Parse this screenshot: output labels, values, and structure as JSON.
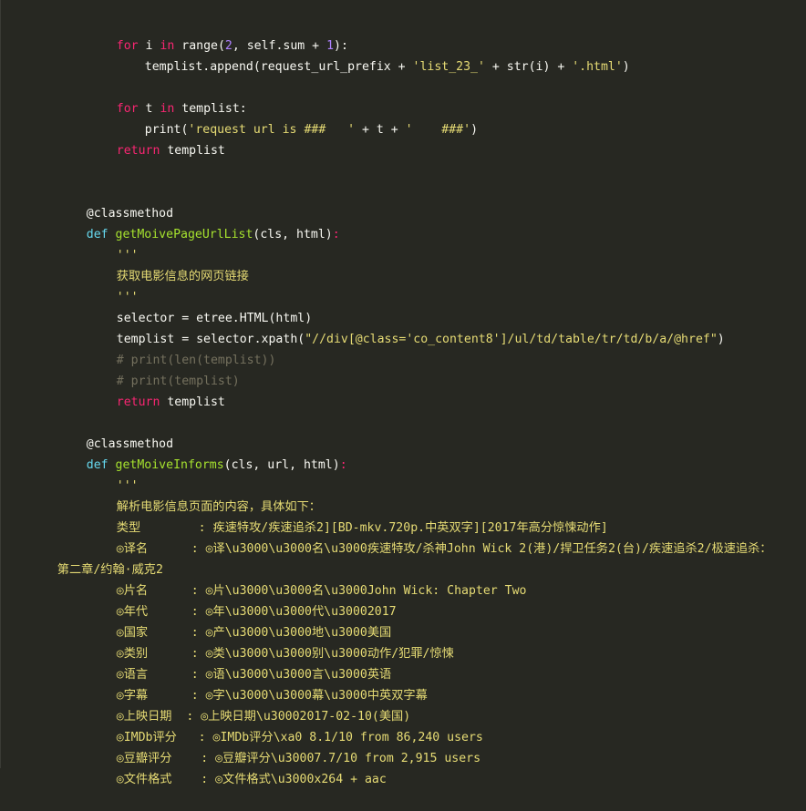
{
  "code_block": {
    "language": "python",
    "theme_colors": {
      "background": "#272822",
      "keyword": "#f92672",
      "def_keyword": "#66d9ef",
      "function_name": "#a6e22e",
      "number": "#ae81ff",
      "string": "#e6db74",
      "comment": "#75715e",
      "text": "#f8f8f2"
    },
    "lines": {
      "l1": {
        "kw1": "for",
        "a": " i ",
        "kw2": "in",
        "b": " range(",
        "n1": "2",
        "c": ", self.sum + ",
        "n2": "1",
        "d": "):"
      },
      "l2": {
        "a": "templist.append(request_url_prefix + ",
        "s1": "'list_23_'",
        "b": " + str(i) + ",
        "s2": "'.html'",
        "c": ")"
      },
      "l3": {
        "kw1": "for",
        "a": " t ",
        "kw2": "in",
        "b": " templist:"
      },
      "l4": {
        "a": "print(",
        "s1": "'request url is ###   '",
        "b": " + t + ",
        "s2": "'    ###'",
        "c": ")"
      },
      "l5": {
        "kw": "return",
        "a": " templist"
      },
      "l6": {
        "text": "@classmethod"
      },
      "l7": {
        "kw": "def",
        "fn": "getMoivePageUrlList",
        "a": "(cls, html)",
        "colon": ":"
      },
      "l8": {
        "doc": "'''"
      },
      "l9": {
        "doc": "获取电影信息的网页链接"
      },
      "l10": {
        "doc": "'''"
      },
      "l11": {
        "a": "selector = etree.HTML(html)"
      },
      "l12": {
        "a": "templist = selector.xpath(",
        "s1": "\"//div[@class='co_content8']/ul/td/table/tr/td/b/a/@href\"",
        "b": ")"
      },
      "l13": {
        "cmt": "# print(len(templist))"
      },
      "l14": {
        "cmt": "# print(templist)"
      },
      "l15": {
        "kw": "return",
        "a": " templist"
      },
      "l16": {
        "text": "@classmethod"
      },
      "l17": {
        "kw": "def",
        "fn": "getMoiveInforms",
        "a": "(cls, url, html)",
        "colon": ":"
      },
      "l18": {
        "doc": "'''"
      },
      "l19": {
        "doc": "解析电影信息页面的内容，具体如下："
      },
      "l20": {
        "doc": "类型        : 疾速特攻/疾速追杀2][BD-mkv.720p.中英双字][2017年高分惊悚动作]"
      },
      "l21": {
        "doc": "◎译名      : ◎译\\u3000\\u3000名\\u3000疾速特攻/杀神John Wick 2(港)/捍卫任务2(台)/疾速追杀2/极速追杀："
      },
      "l22": {
        "doc": "第二章/约翰·威克2"
      },
      "l23": {
        "doc": "◎片名      : ◎片\\u3000\\u3000名\\u3000John Wick: Chapter Two"
      },
      "l24": {
        "doc": "◎年代      : ◎年\\u3000\\u3000代\\u30002017"
      },
      "l25": {
        "doc": "◎国家      : ◎产\\u3000\\u3000地\\u3000美国"
      },
      "l26": {
        "doc": "◎类别      : ◎类\\u3000\\u3000别\\u3000动作/犯罪/惊悚"
      },
      "l27": {
        "doc": "◎语言      : ◎语\\u3000\\u3000言\\u3000英语"
      },
      "l28": {
        "doc": "◎字幕      : ◎字\\u3000\\u3000幕\\u3000中英双字幕"
      },
      "l29": {
        "doc": "◎上映日期  : ◎上映日期\\u30002017-02-10(美国)"
      },
      "l30": {
        "doc": "◎IMDb评分   : ◎IMDb评分\\xa0 8.1/10 from 86,240 users"
      },
      "l31": {
        "doc": "◎豆瓣评分    : ◎豆瓣评分\\u30007.7/10 from 2,915 users"
      },
      "l32": {
        "doc": "◎文件格式    : ◎文件格式\\u3000x264 + aac"
      }
    }
  }
}
